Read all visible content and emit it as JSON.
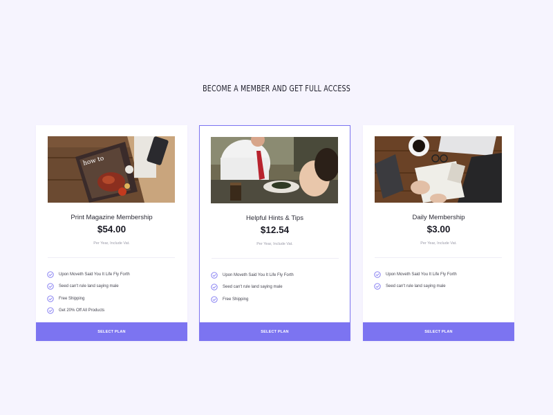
{
  "heading": "BECOME A MEMBER AND GET FULL ACCESS",
  "colors": {
    "accent": "#7c74f1",
    "background": "#f6f4fe",
    "card": "#ffffff"
  },
  "plans": [
    {
      "title": "Print Magazine Membership",
      "price": "$54.00",
      "period": "Per Year, Include Vat.",
      "features": [
        "Upon Moveth Said You It Life Fly Forth",
        "Seed can't rule land saying male",
        "Free Shipping",
        "Get 20% Off All Products"
      ],
      "button": "SELECT PLAN",
      "featured": false
    },
    {
      "title": "Helpful Hints & Tips",
      "price": "$12.54",
      "period": "Per Year, Include Vat.",
      "features": [
        "Upon Moveth Said You It Life Fly Forth",
        "Seed can't rule land saying male",
        "Free Shipping"
      ],
      "button": "SELECT PLAN",
      "featured": true
    },
    {
      "title": "Daily Membership",
      "price": "$3.00",
      "period": "Per Year, Include Vat.",
      "features": [
        "Upon Moveth Said You It Life Fly Forth",
        "Seed can't rule land saying male"
      ],
      "button": "SELECT PLAN",
      "featured": false
    }
  ],
  "icons": {
    "feature": "check-circle-icon"
  }
}
